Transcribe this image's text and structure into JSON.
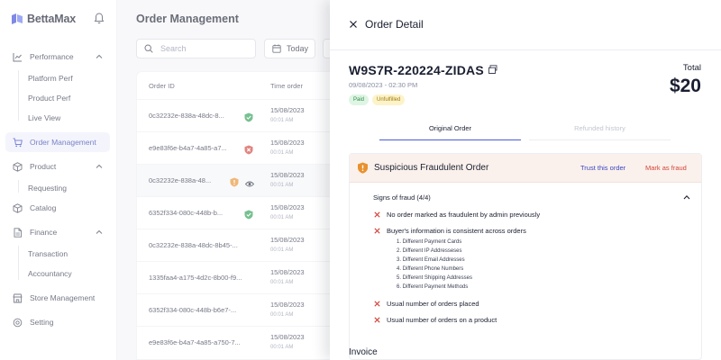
{
  "brand": {
    "name": "BettaMax",
    "sub": "..."
  },
  "sidebar": {
    "performance": "Performance",
    "perf_items": [
      "Platform Perf",
      "Product Perf",
      "Live View"
    ],
    "order_mgmt": "Order Management",
    "product": "Product",
    "product_items": [
      "Requesting",
      "Catalog"
    ],
    "finance": "Finance",
    "finance_items": [
      "Transaction",
      "Accountancy"
    ],
    "store_mgmt": "Store Management",
    "setting": "Setting"
  },
  "main": {
    "title": "Order Management",
    "search_placeholder": "Search",
    "date_filter": "Today",
    "col_order_id": "Order ID",
    "col_time": "Time order",
    "rows": [
      {
        "id": "0c32232e-838a-48dc-8...",
        "status": "verified",
        "date": "15/08/2023",
        "time": "00:01 AM"
      },
      {
        "id": "e9e83f6e-b4a7-4a85-a7...",
        "status": "fraud",
        "date": "15/08/2023",
        "time": "00:01 AM"
      },
      {
        "id": "0c32232e-838a-48...",
        "status": "suspicious",
        "date": "15/08/2023",
        "time": "00:01 AM"
      },
      {
        "id": "6352f334-080c-448b-b...",
        "status": "verified",
        "date": "15/08/2023",
        "time": "00:01 AM"
      },
      {
        "id": "0c32232e-838a-48dc-8b45-...",
        "status": "none",
        "date": "15/08/2023",
        "time": "00:01 AM"
      },
      {
        "id": "1335faa4-a175-4d2c-8b00-f9...",
        "status": "none",
        "date": "15/08/2023",
        "time": "00:01 AM"
      },
      {
        "id": "6352f334-080c-448b-b6e7-...",
        "status": "none",
        "date": "15/08/2023",
        "time": "00:01 AM"
      },
      {
        "id": "e9e83f6e-b4a7-4a85-a750-7...",
        "status": "none",
        "date": "15/08/2023",
        "time": "00:01 AM"
      }
    ]
  },
  "detail": {
    "title": "Order Detail",
    "order_id": "W9S7R-220224-ZIDAS",
    "order_date": "09/08/2023 - 02:30 PM",
    "badge_paid": "Paid",
    "badge_unfulfilled": "Unfulfilled",
    "total_label": "Total",
    "total_value": "$20",
    "tab_original": "Original Order",
    "tab_refunded": "Refunded history",
    "fraud": {
      "title": "Suspicious Fraudulent Order",
      "trust": "Trust this order",
      "mark": "Mark as fraud",
      "signs_label": "Signs of fraud (4/4)",
      "signs": [
        "No order marked as fraudulent by admin previously",
        "Buyer's information is consistent across orders",
        "Usual number of orders placed",
        "Usual number of orders on a product"
      ],
      "sublist": [
        "1. Different Payment Cards",
        "2. Different IP Addresseses",
        "3. Different Email Addresses",
        "4. Different Phone Numbers",
        "5. Different Shipping Addresses",
        "6. Different Payment Methods"
      ]
    },
    "invoice": "Invoice"
  },
  "colors": {
    "accent": "#3a46c2",
    "danger": "#d2443b",
    "warning": "#e8912e",
    "success": "#2f9e57"
  }
}
